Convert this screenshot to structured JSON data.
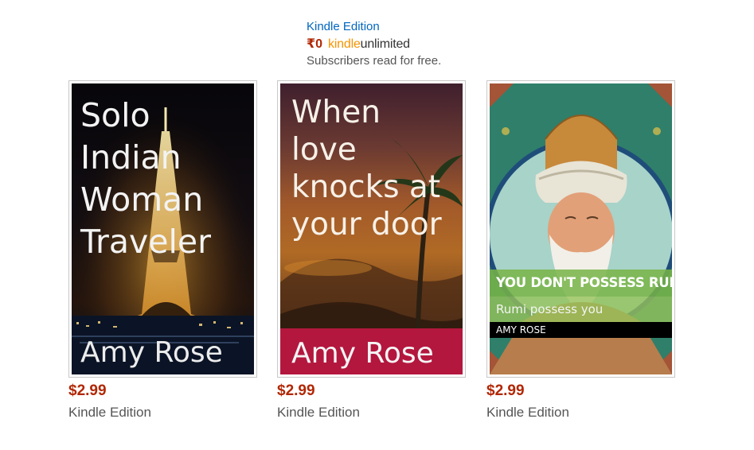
{
  "top_offer": {
    "format_link": "Kindle Edition",
    "ku_price": "₹0",
    "ku_logo_kindle": "kindle",
    "ku_logo_unlimited": "unlimited",
    "subscribers_text": "Subscribers read for free."
  },
  "colors": {
    "link": "#0066c0",
    "price": "#b12704",
    "ku_orange": "#f79400",
    "muted": "#555555"
  },
  "books": [
    {
      "cover_title": [
        "Solo",
        "Indian",
        "Woman",
        "Traveler"
      ],
      "cover_author": "Amy Rose",
      "price": "$2.99",
      "format": "Kindle Edition"
    },
    {
      "cover_title": [
        "When",
        "love",
        "knocks at",
        "your door"
      ],
      "cover_author": "Amy Rose",
      "price": "$2.99",
      "format": "Kindle Edition"
    },
    {
      "cover_title": "YOU DON'T POSSESS RUMI",
      "cover_subtitle": "Rumi possess you",
      "cover_author": "AMY ROSE",
      "price": "$2.99",
      "format": "Kindle Edition"
    }
  ]
}
